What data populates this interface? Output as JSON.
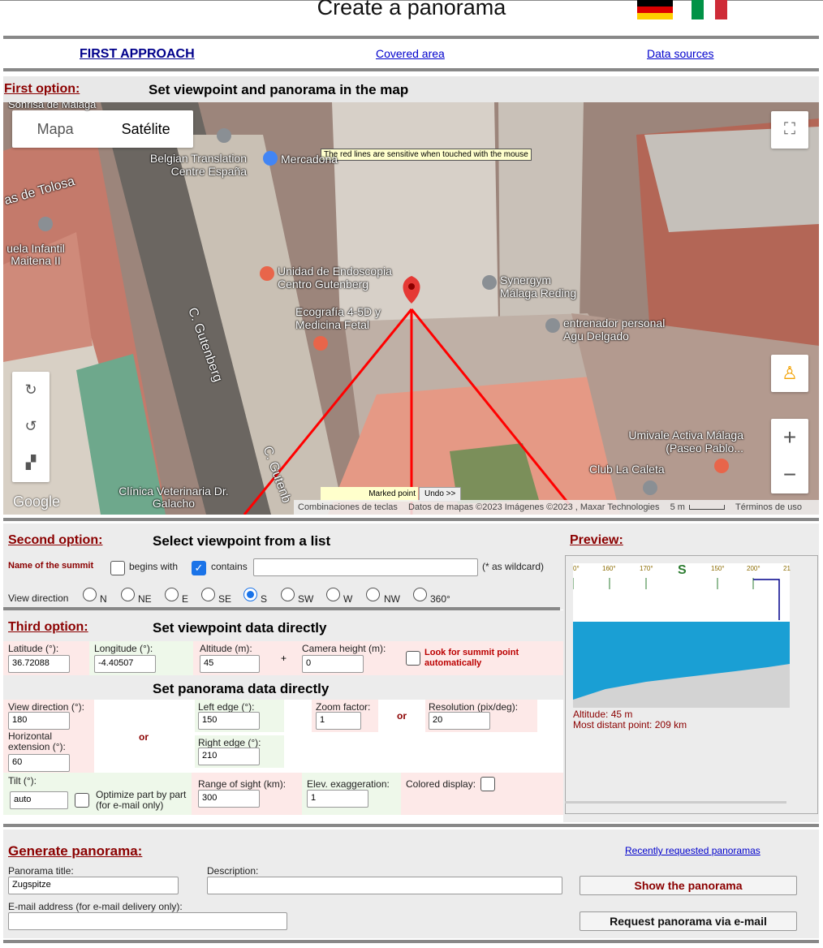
{
  "page_title": "Create a panorama",
  "nav": {
    "first": "FIRST APPROACH",
    "covered": "Covered area",
    "sources": "Data sources"
  },
  "first_option": {
    "label": "First option:",
    "heading": "Set viewpoint and panorama in the map"
  },
  "map": {
    "type_map": "Mapa",
    "type_satellite": "Satélite",
    "tooltip": "The red lines are sensitive when touched with the mouse",
    "marked_point": "Marked point",
    "undo": "Undo >>",
    "google": "Google",
    "footer_keys": "Combinaciones de teclas",
    "footer_data": "Datos de mapas ©2023 Imágenes ©2023 , Maxar Technologies",
    "footer_scale": "5 m",
    "footer_terms": "Términos de uso",
    "places": [
      "Sonrisa de Malaga",
      "Belgian Translation Centre España",
      "Mercadona",
      "as de Tolosa",
      "uela Infantil Maitena II",
      "Unidad de Endoscopia Centro Gutenberg",
      "Synergym Málaga Reding",
      "Ecografía 4-5D y Medicina Fetal",
      "entrenador personal Agu Delgado",
      "C. Gutenberg",
      "Umivale Activa Málaga (Paseo Pablo...",
      "Club La Caleta",
      "Clínica Veterinaria Dr. Galacho",
      "C. Gutenb"
    ]
  },
  "second_option": {
    "label": "Second option:",
    "heading": "Select viewpoint from a list",
    "summit_label": "Name of the summit",
    "begins_with": "begins with",
    "contains": "contains",
    "summit_value": "",
    "wildcard": "(* as wildcard)",
    "view_direction": "View direction",
    "directions": [
      "N",
      "NE",
      "E",
      "SE",
      "S",
      "SW",
      "W",
      "NW",
      "360°"
    ],
    "selected_direction": "S"
  },
  "preview": {
    "label": "Preview:",
    "ticks": [
      "0°",
      "160°",
      "170°",
      "S",
      "150°",
      "200°",
      "21"
    ],
    "altitude": "Altitude: 45 m",
    "distant": "Most distant point: 209 km",
    "sky_color": "#1a9fd4",
    "ground_color": "#d3d3d3"
  },
  "third_option": {
    "label": "Third option:",
    "heading": "Set viewpoint data directly",
    "latitude_label": "Latitude (°):",
    "latitude": "36.72088",
    "longitude_label": "Longitude (°):",
    "longitude": "-4.40507",
    "altitude_label": "Altitude (m):",
    "altitude": "45",
    "plus": "+",
    "camera_label": "Camera height (m):",
    "camera": "0",
    "summit_auto": "Look for summit point automatically"
  },
  "panorama": {
    "heading": "Set panorama data directly",
    "view_dir_label": "View direction (°):",
    "view_dir": "180",
    "h_ext_label": "Horizontal extension (°):",
    "h_ext": "60",
    "or": "or",
    "left_label": "Left edge (°):",
    "left": "150",
    "right_label": "Right edge (°):",
    "right": "210",
    "zoom_label": "Zoom factor:",
    "zoom": "1",
    "res_label": "Resolution (pix/deg):",
    "res": "20",
    "tilt_label": "Tilt (°):",
    "tilt": "auto",
    "optimize": "Optimize part by part (for e-mail only)",
    "range_label": "Range of sight (km):",
    "range": "300",
    "elev_label": "Elev. exaggeration:",
    "elev": "1",
    "colored_label": "Colored display:"
  },
  "generate": {
    "label": "Generate panorama:",
    "recent": "Recently requested panoramas",
    "title_label": "Panorama title:",
    "title_value": "Zugspitze",
    "desc_label": "Description:",
    "desc_value": "",
    "email_label": "E-mail address (for e-mail delivery only):",
    "email_value": "",
    "show": "Show the panorama",
    "request": "Request panorama via e-mail"
  }
}
